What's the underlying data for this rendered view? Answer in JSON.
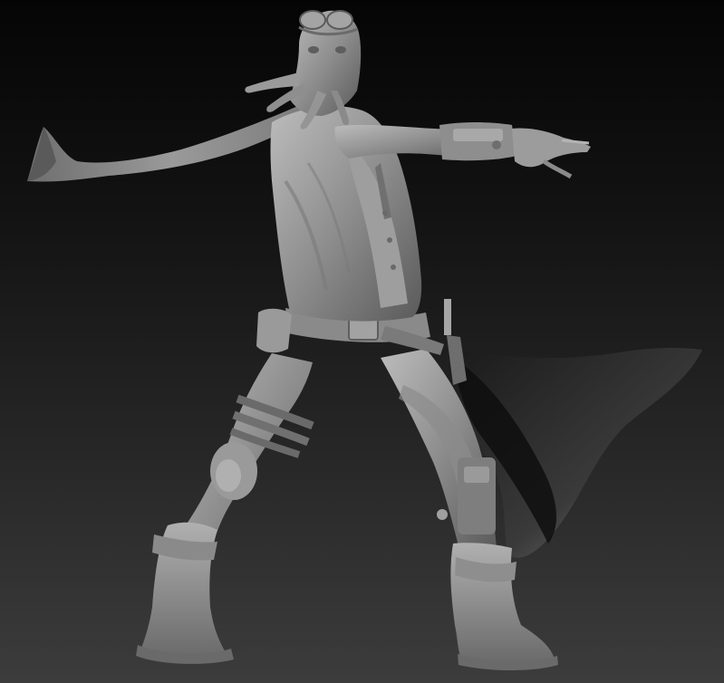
{
  "scene": {
    "subject": "sculpted-character",
    "colors": {
      "background_top": "#050505",
      "background_bottom": "#3c3c3c",
      "clay_light": "#a8a8a8",
      "clay_mid": "#8a8a8a",
      "clay_dark": "#5e5e5e",
      "cape_inner": "#141414"
    }
  }
}
